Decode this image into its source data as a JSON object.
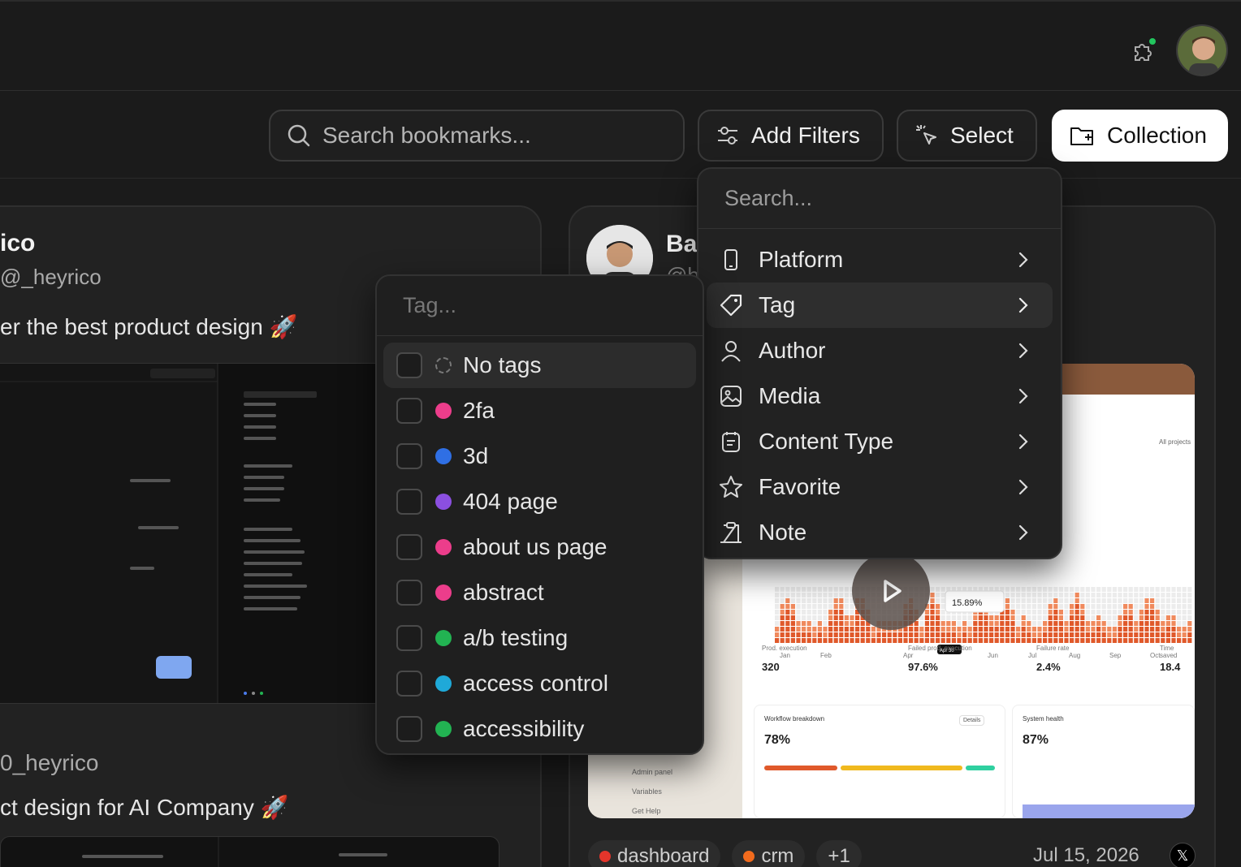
{
  "header": {
    "avatar_alt": "user avatar"
  },
  "toolbar": {
    "search_placeholder": "Search bookmarks...",
    "filters_label": "Add Filters",
    "select_label": "Select",
    "collection_label": "Collection"
  },
  "filter_menu": {
    "search_placeholder": "Search...",
    "items": [
      {
        "label": "Platform",
        "icon": "phone-icon"
      },
      {
        "label": "Tag",
        "icon": "tag-icon"
      },
      {
        "label": "Author",
        "icon": "user-icon"
      },
      {
        "label": "Media",
        "icon": "image-icon"
      },
      {
        "label": "Content Type",
        "icon": "document-icon"
      },
      {
        "label": "Favorite",
        "icon": "star-icon"
      },
      {
        "label": "Note",
        "icon": "clipboard-icon"
      }
    ]
  },
  "tag_menu": {
    "search_placeholder": "Tag...",
    "items": [
      {
        "label": "No tags",
        "color": ""
      },
      {
        "label": "2fa",
        "color": "#ec3d8b"
      },
      {
        "label": "3d",
        "color": "#2f6fe4"
      },
      {
        "label": "404 page",
        "color": "#8b4fe0"
      },
      {
        "label": "about us page",
        "color": "#ec3d8b"
      },
      {
        "label": "abstract",
        "color": "#ec3d8b"
      },
      {
        "label": "a/b testing",
        "color": "#22b352"
      },
      {
        "label": "access control",
        "color": "#1fa9d8"
      },
      {
        "label": "accessibility",
        "color": "#22b352"
      }
    ]
  },
  "card_left": {
    "name": "ico",
    "handle": "@_heyrico",
    "text": "er the best product design 🚀",
    "handle2": "0_heyrico",
    "text2": "ct design for AI Company 🚀"
  },
  "card_right": {
    "name": "Bar",
    "handle": "@b",
    "tags": [
      {
        "label": "dashboard",
        "color": "#e5352b"
      },
      {
        "label": "crm",
        "color": "#f26b1d"
      },
      {
        "label": "+1",
        "color": ""
      }
    ],
    "date": "Jul 15, 2026",
    "source_icon": "x-logo-icon",
    "dashboard": {
      "stats": [
        {
          "label": "Prod. execution",
          "value": "320"
        },
        {
          "label": "Failed prod. execution",
          "value": "97.6%"
        },
        {
          "label": "Failure rate",
          "value": "2.4%"
        },
        {
          "label": "Time saved",
          "value": "18.4"
        }
      ],
      "tooltip": "15.89%",
      "tooltip_date": "Apr 30",
      "workflow_title": "Workflow breakdown",
      "workflow_value": "78%",
      "health_title": "System health",
      "health_value": "87%",
      "details_label": "Details",
      "side_items": [
        "Admin panel",
        "Variables",
        "Get Help"
      ],
      "months": [
        "Jan",
        "Feb",
        "Apr",
        "Jun",
        "Jul",
        "Aug",
        "Sep",
        "Oct"
      ],
      "all_projects": "All projects"
    }
  }
}
